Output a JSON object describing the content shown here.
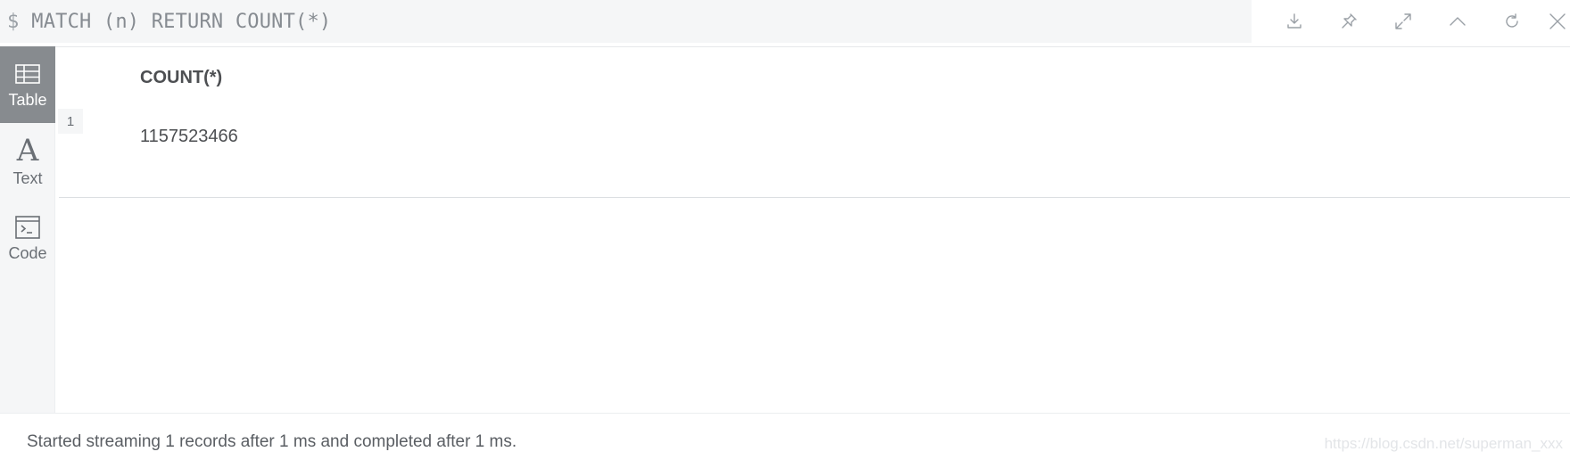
{
  "query": {
    "prompt": "$",
    "text": "MATCH (n) RETURN COUNT(*)"
  },
  "actions": [
    {
      "icon": "download-icon"
    },
    {
      "icon": "pin-icon"
    },
    {
      "icon": "expand-icon"
    },
    {
      "icon": "collapse-up-icon"
    },
    {
      "icon": "rerun-icon"
    },
    {
      "icon": "close-icon"
    }
  ],
  "sidebar": {
    "items": [
      {
        "label": "Table",
        "icon": "table-icon",
        "active": true
      },
      {
        "label": "Text",
        "icon": "text-icon",
        "glyph": "A",
        "active": false
      },
      {
        "label": "Code",
        "icon": "code-icon",
        "active": false
      }
    ]
  },
  "table": {
    "columns": [
      "COUNT(*)"
    ],
    "rows": [
      {
        "index": "1",
        "cells": [
          "1157523466"
        ]
      }
    ]
  },
  "status": "Started streaming 1 records after 1 ms and completed after 1 ms.",
  "watermark": "https://blog.csdn.net/superman_xxx",
  "colors": {
    "active_tab_bg": "#878b8f",
    "sidebar_bg": "#f5f6f7",
    "text": "#4d4f52",
    "icon": "#9aa0a6"
  }
}
